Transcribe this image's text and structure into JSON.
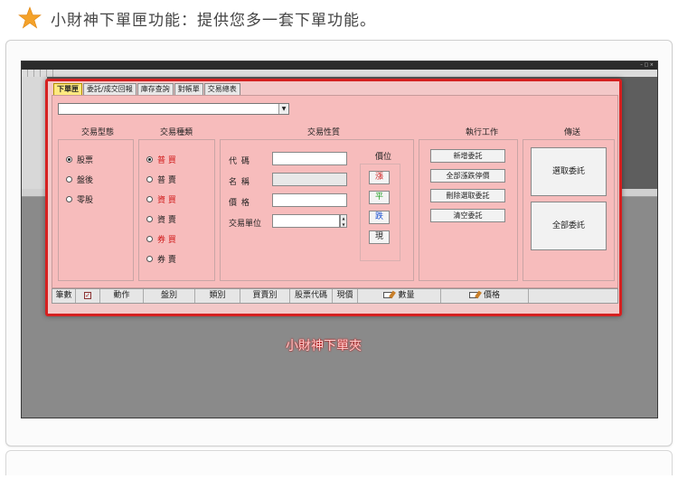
{
  "heading": {
    "icon": "star-icon",
    "text": "小財神下單匣功能：提供您多一套下單功能。",
    "icon_color": "#f4a22a"
  },
  "caption": "小財神下單夾",
  "tabs": [
    "下單匣",
    "委託/成交回報",
    "庫存查詢",
    "對帳單",
    "交易總表"
  ],
  "groups": {
    "type": {
      "title": "交易型態",
      "options": [
        "股票",
        "盤後",
        "零股"
      ],
      "selected": "股票"
    },
    "kind": {
      "title": "交易種類",
      "options": [
        "普  買",
        "普  賣",
        "資  買",
        "資  賣",
        "券  買",
        "券  賣"
      ],
      "selected": "普  買"
    },
    "nature": {
      "title": "交易性質",
      "fields": {
        "code": "代  碼",
        "name": "名  稱",
        "price": "價  格",
        "unit": "交易單位"
      },
      "price_title": "價位",
      "price_buttons": [
        "漲",
        "平",
        "跌",
        "現"
      ]
    },
    "actions": {
      "title": "執行工作",
      "buttons": [
        "新增委託",
        "全部漲跌停價",
        "刪除選取委託",
        "清空委託"
      ]
    },
    "send": {
      "title": "傳送",
      "buttons": [
        "選取委託",
        "全部委託"
      ]
    }
  },
  "columns": [
    "筆數",
    "動作",
    "盤別",
    "類別",
    "買賣別",
    "股票代碼",
    "現價",
    "數量",
    "價格"
  ],
  "colors": {
    "accent_red": "#d62020",
    "form_bg": "#f7bcbc",
    "rise": "#d01818",
    "flat": "#1a9a1a",
    "fall": "#1a4fd0"
  }
}
